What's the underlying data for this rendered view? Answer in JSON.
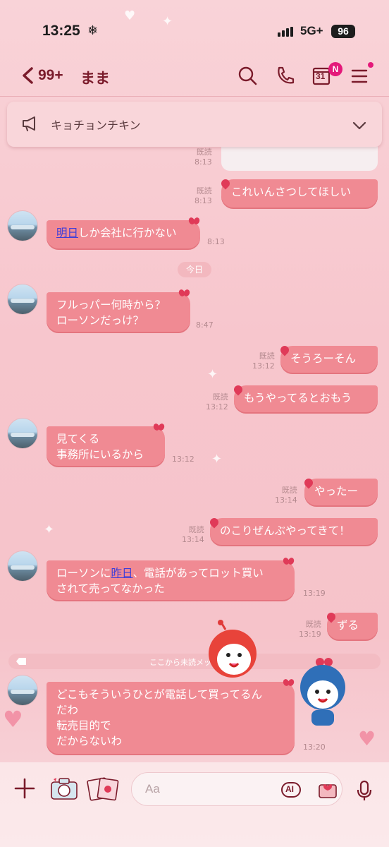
{
  "status": {
    "time": "13:25",
    "network": "5G+",
    "battery": "96"
  },
  "header": {
    "back_count": "99+",
    "chat_title": "まま",
    "calendar_day": "31",
    "badge": "N"
  },
  "announcement": {
    "text": "キョチョンチキン"
  },
  "messages": [
    {
      "side": "right",
      "read": "既読",
      "time": "8:13",
      "text": "これいんさつしてほしい"
    },
    {
      "side": "left",
      "time": "8:13",
      "link": "明日",
      "rest": "しか会社に行かない"
    },
    {
      "side": "left",
      "time": "8:47",
      "line1": "フルっパー何時から？",
      "line2": "ローソンだっけ？"
    },
    {
      "side": "right",
      "read": "既読",
      "time": "13:12",
      "text": "そうろーそん"
    },
    {
      "side": "right",
      "read": "既読",
      "time": "13:12",
      "text": "もうやってるとおもう"
    },
    {
      "side": "left",
      "time": "13:12",
      "line1": "見てくる",
      "line2": "事務所にいるから"
    },
    {
      "side": "right",
      "read": "既読",
      "time": "13:14",
      "text": "やったー"
    },
    {
      "side": "right",
      "read": "既読",
      "time": "13:14",
      "text": "のこりぜんぶやってきて！"
    },
    {
      "side": "left",
      "time": "13:19",
      "pre": "ローソンに",
      "link": "昨日",
      "post": "、電話があってロット買い",
      "line2": "されて売ってなかった"
    },
    {
      "side": "right",
      "read": "既読",
      "time": "13:19",
      "text": "ずる"
    },
    {
      "side": "left",
      "time": "13:20",
      "line1": "どこもそういうひとが電話して買ってるん",
      "line2": "だわ",
      "line3": "転売目的で",
      "line4": "だからないわ"
    }
  ],
  "top_partial": {
    "read": "既読",
    "time": "8:13"
  },
  "date_divider": "今日",
  "unread_divider": "ここから未読メッセ",
  "input": {
    "placeholder": "Aa",
    "ai_label": "AI"
  },
  "icons": [
    "back-chevron-icon",
    "search-icon",
    "phone-icon",
    "calendar-icon",
    "menu-icon",
    "megaphone-icon",
    "chevron-down-icon",
    "plus-icon",
    "camera-icon",
    "stamp-icon",
    "ai-icon",
    "gift-icon",
    "mic-icon"
  ],
  "colors": {
    "bubble": "#f08a93",
    "header_text": "#7a1b2b",
    "badge": "#e4197a",
    "background": "#f7c6cd"
  }
}
